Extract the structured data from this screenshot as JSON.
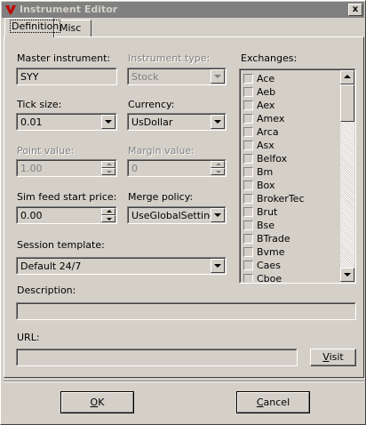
{
  "window": {
    "title": "Instrument Editor",
    "close_glyph": "x"
  },
  "tabs": [
    {
      "label": "Definition",
      "active": true
    },
    {
      "label": "Misc",
      "active": false
    }
  ],
  "form": {
    "master_instrument": {
      "label": "Master instrument:",
      "value": "SYY"
    },
    "instrument_type": {
      "label": "Instrument type:",
      "value": "Stock",
      "disabled": true
    },
    "tick_size": {
      "label": "Tick size:",
      "value": "0.01"
    },
    "currency": {
      "label": "Currency:",
      "value": "UsDollar"
    },
    "point_value": {
      "label": "Point value:",
      "value": "1.00",
      "disabled": true
    },
    "margin_value": {
      "label": "Margin value:",
      "value": "0",
      "disabled": true
    },
    "sim_feed_start_price": {
      "label": "Sim feed start price:",
      "value": "0.00"
    },
    "merge_policy": {
      "label": "Merge policy:",
      "value": "UseGlobalSettings"
    },
    "session_template": {
      "label": "Session template:",
      "value": "Default 24/7"
    },
    "description": {
      "label": "Description:",
      "value": ""
    },
    "url": {
      "label": "URL:",
      "value": ""
    }
  },
  "exchanges": {
    "label": "Exchanges:",
    "items": [
      "Ace",
      "Aeb",
      "Aex",
      "Amex",
      "Arca",
      "Asx",
      "Belfox",
      "Bm",
      "Box",
      "BrokerTec",
      "Brut",
      "Bse",
      "BTrade",
      "Bvme",
      "Caes",
      "Cboe"
    ]
  },
  "buttons": {
    "visit_prefix": "V",
    "visit_rest": "isit",
    "ok_prefix": "O",
    "ok_rest": "K",
    "cancel_prefix": "C",
    "cancel_rest": "ancel"
  },
  "icons": {
    "app": "ninja-logo-icon",
    "close": "close-icon",
    "dropdown": "chevron-down-icon",
    "spin_up": "spin-up-icon",
    "spin_down": "spin-down-icon"
  },
  "colors": {
    "face": "#d4d0c8",
    "titlebar_inactive": "#808080",
    "logo_red": "#c00000"
  }
}
